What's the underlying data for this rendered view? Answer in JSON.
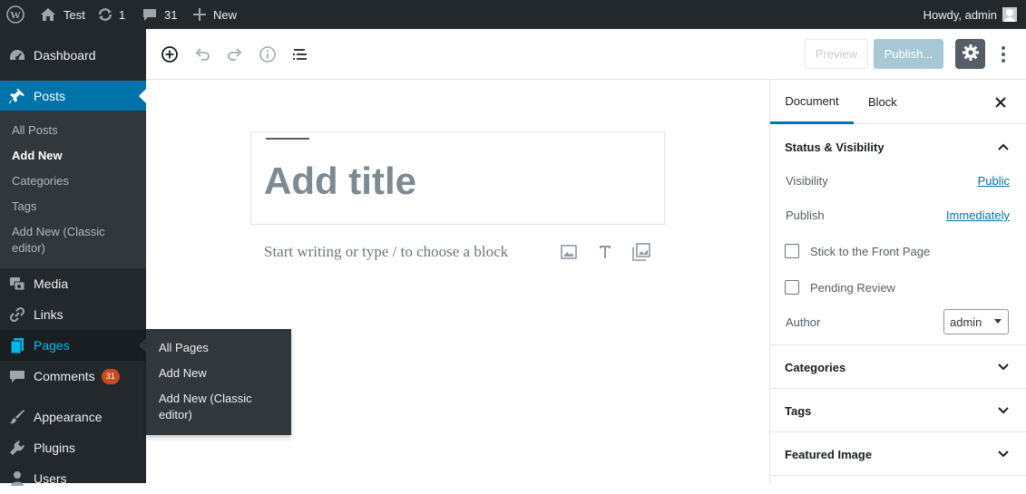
{
  "admin_bar": {
    "site_name": "Test",
    "updates_count": "1",
    "comments_count": "31",
    "new_label": "New",
    "howdy": "Howdy, admin"
  },
  "sidebar": {
    "dashboard": "Dashboard",
    "posts": "Posts",
    "posts_submenu": [
      "All Posts",
      "Add New",
      "Categories",
      "Tags",
      "Add New (Classic",
      "editor)"
    ],
    "media": "Media",
    "links": "Links",
    "pages": "Pages",
    "comments": "Comments",
    "comments_badge": "31",
    "appearance": "Appearance",
    "plugins": "Plugins",
    "users": "Users"
  },
  "pages_flyout": [
    "All Pages",
    "Add New",
    "Add New (Classic",
    "editor)"
  ],
  "toolbar": {
    "preview_label": "Preview",
    "publish_label": "Publish..."
  },
  "editor": {
    "title_placeholder": "Add title",
    "block_placeholder": "Start writing or type / to choose a block"
  },
  "settings_panel": {
    "tabs": [
      "Document",
      "Block"
    ],
    "status_section": "Status & Visibility",
    "visibility_label": "Visibility",
    "visibility_value": "Public",
    "publish_label": "Publish",
    "publish_value": "Immediately",
    "stick_label": "Stick to the Front Page",
    "pending_label": "Pending Review",
    "author_label": "Author",
    "author_value": "admin",
    "categories_section": "Categories",
    "tags_section": "Tags",
    "featured_image_section": "Featured Image"
  },
  "colors": {
    "admin_dark": "#23282d",
    "submenu_bg": "#32373c",
    "accent": "#0073aa",
    "hover_blue": "#00b9eb",
    "badge": "#ca4a1f"
  }
}
